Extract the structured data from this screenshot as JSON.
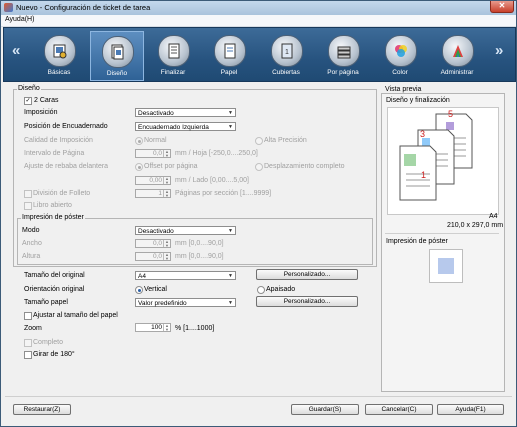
{
  "window": {
    "title": "Nuevo - Configuración de ticket de tarea",
    "close_glyph": "✕"
  },
  "menu": {
    "help": "Ayuda(H)"
  },
  "toolbar": {
    "left_arrow": "«",
    "right_arrow": "»",
    "items": [
      {
        "label": "Básicas",
        "icon": "basic-settings-icon"
      },
      {
        "label": "Diseño",
        "icon": "layout-icon"
      },
      {
        "label": "Finalizar",
        "icon": "finishing-icon"
      },
      {
        "label": "Papel",
        "icon": "paper-icon"
      },
      {
        "label": "Cubiertas",
        "icon": "covers-icon"
      },
      {
        "label": "Por página",
        "icon": "per-page-icon"
      },
      {
        "label": "Color",
        "icon": "color-icon"
      },
      {
        "label": "Administrar",
        "icon": "administer-icon"
      }
    ]
  },
  "layout": {
    "group_title": "Diseño",
    "two_sided": "2 Caras",
    "check_mark": "✓",
    "imposition_label": "Imposición",
    "imposition_value": "Desactivado",
    "binding_label": "Posición de Encuadernado",
    "binding_value": "Encuadernado Izquierda",
    "imposition_quality_label": "Calidad de Imposición",
    "quality_normal": "Normal",
    "quality_high": "Alta Precisión",
    "page_interval_label": "Intervalo de Página",
    "page_interval_value": "0,0",
    "page_interval_unit": "mm / Hoja [-250,0....250,0]",
    "creep_label": "Ajuste de rebaba delantera",
    "creep_offset": "Offset por página",
    "creep_full": "Desplazamiento completo",
    "creep_value": "0,00",
    "creep_unit": "mm / Lado [0,00....5,00]",
    "booklet_split_label": "División de Folleto",
    "booklet_split_value": "1",
    "booklet_split_unit": "Páginas por sección [1....9999]",
    "open_book": "Libro abierto",
    "poster": {
      "title": "Impresión de póster",
      "mode_label": "Modo",
      "mode_value": "Desactivado",
      "width_label": "Ancho",
      "width_value": "0,0",
      "width_unit": "mm [0,0....90,0]",
      "height_label": "Altura",
      "height_value": "0,0",
      "height_unit": "mm [0,0....90,0]"
    },
    "original_size_label": "Tamaño del original",
    "original_size_value": "A4",
    "custom_button": "Personalizado...",
    "orientation_label": "Orientación original",
    "orientation_vertical": "Vertical",
    "orientation_horizontal": "Apaisado",
    "paper_size_label": "Tamaño papel",
    "paper_size_value": "Valor predefinido",
    "fit_paper": "Ajustar al tamaño del papel",
    "zoom_label": "Zoom",
    "zoom_value": "100",
    "zoom_unit": "% [1....1000]",
    "complete": "Completo",
    "rotate": "Girar de 180°"
  },
  "preview": {
    "title": "Vista previa",
    "subtitle": "Diseño y finalización",
    "pages": [
      "5",
      "3",
      "1"
    ],
    "paper_name": "A4",
    "paper_dims": "210,0 x 297,0 mm",
    "poster_title": "Impresión de póster"
  },
  "footer": {
    "restore": "Restaurar(Z)",
    "save": "Guardar(S)",
    "cancel": "Cancelar(C)",
    "help": "Ayuda(F1)"
  },
  "colors": {
    "toolbar": "#27537f",
    "accent": "#2a5fa6",
    "page_number": "#cc2020"
  }
}
